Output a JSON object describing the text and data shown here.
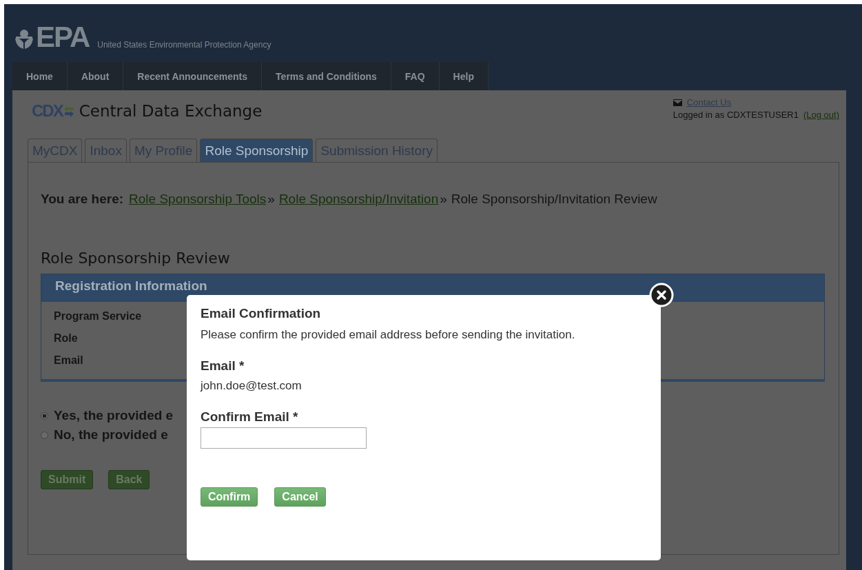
{
  "header": {
    "logo_text": "EPA",
    "agency_name": "United States Environmental Protection Agency"
  },
  "nav": [
    "Home",
    "About",
    "Recent Announcements",
    "Terms and Conditions",
    "FAQ",
    "Help"
  ],
  "site": {
    "logo_text": "CDX",
    "title": "Central Data Exchange"
  },
  "user": {
    "contact": "Contact Us",
    "logged_in": "Logged in as CDXTESTUSER1",
    "logout": "(Log out)"
  },
  "tabs": [
    {
      "label": "MyCDX",
      "selected": false
    },
    {
      "label": "Inbox",
      "selected": false
    },
    {
      "label": "My Profile",
      "selected": false
    },
    {
      "label": "Role Sponsorship",
      "selected": true
    },
    {
      "label": "Submission History",
      "selected": false
    }
  ],
  "breadcrumb": {
    "label": "You are here:",
    "links": [
      "Role Sponsorship Tools",
      "Role Sponsorship/Invitation"
    ],
    "separator": "»",
    "current": "Role Sponsorship/Invitation Review"
  },
  "page_title": "Role Sponsorship Review",
  "panel": {
    "title": "Registration Information",
    "fields": [
      "Program Service",
      "Role",
      "Email"
    ]
  },
  "options": [
    {
      "label": "Yes, the provided e",
      "selected": true
    },
    {
      "label": "No, the provided e",
      "selected": false
    }
  ],
  "buttons": [
    "Submit",
    "Back"
  ],
  "modal": {
    "title": "Email Confirmation",
    "message": "Please confirm the provided email address before sending the invitation.",
    "fields": [
      {
        "kind": "text",
        "label": "Email *",
        "value": "john.doe@test.com"
      },
      {
        "kind": "input",
        "label": "Confirm Email *"
      }
    ],
    "buttons": [
      "Confirm",
      "Cancel"
    ]
  }
}
